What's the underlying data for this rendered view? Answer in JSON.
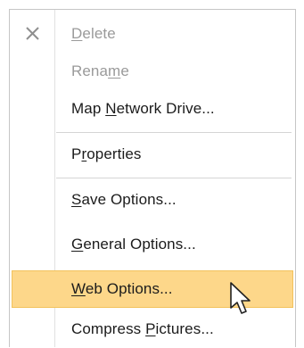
{
  "context_menu": {
    "items": [
      {
        "pre": "",
        "key": "D",
        "post": "elete",
        "disabled": true,
        "icon": "delete-x-icon"
      },
      {
        "pre": "Rena",
        "key": "m",
        "post": "e",
        "disabled": true
      },
      {
        "pre": "Map ",
        "key": "N",
        "post": "etwork Drive...",
        "disabled": false
      },
      {
        "pre": "P",
        "key": "r",
        "post": "operties",
        "disabled": false
      },
      {
        "pre": "",
        "key": "S",
        "post": "ave Options...",
        "disabled": false
      },
      {
        "pre": "",
        "key": "G",
        "post": "eneral Options...",
        "disabled": false
      },
      {
        "pre": "",
        "key": "W",
        "post": "eb Options...",
        "disabled": false,
        "highlighted": true
      },
      {
        "pre": "Compress ",
        "key": "P",
        "post": "ictures...",
        "disabled": false
      }
    ]
  },
  "colors": {
    "highlight_bg": "#fdd78a",
    "highlight_border": "#f2c25c",
    "disabled_text": "#9a9a9a",
    "normal_text": "#1b1b1b",
    "separator": "#d5d5d5"
  },
  "cursor": {
    "icon": "arrow-pointer-icon"
  }
}
